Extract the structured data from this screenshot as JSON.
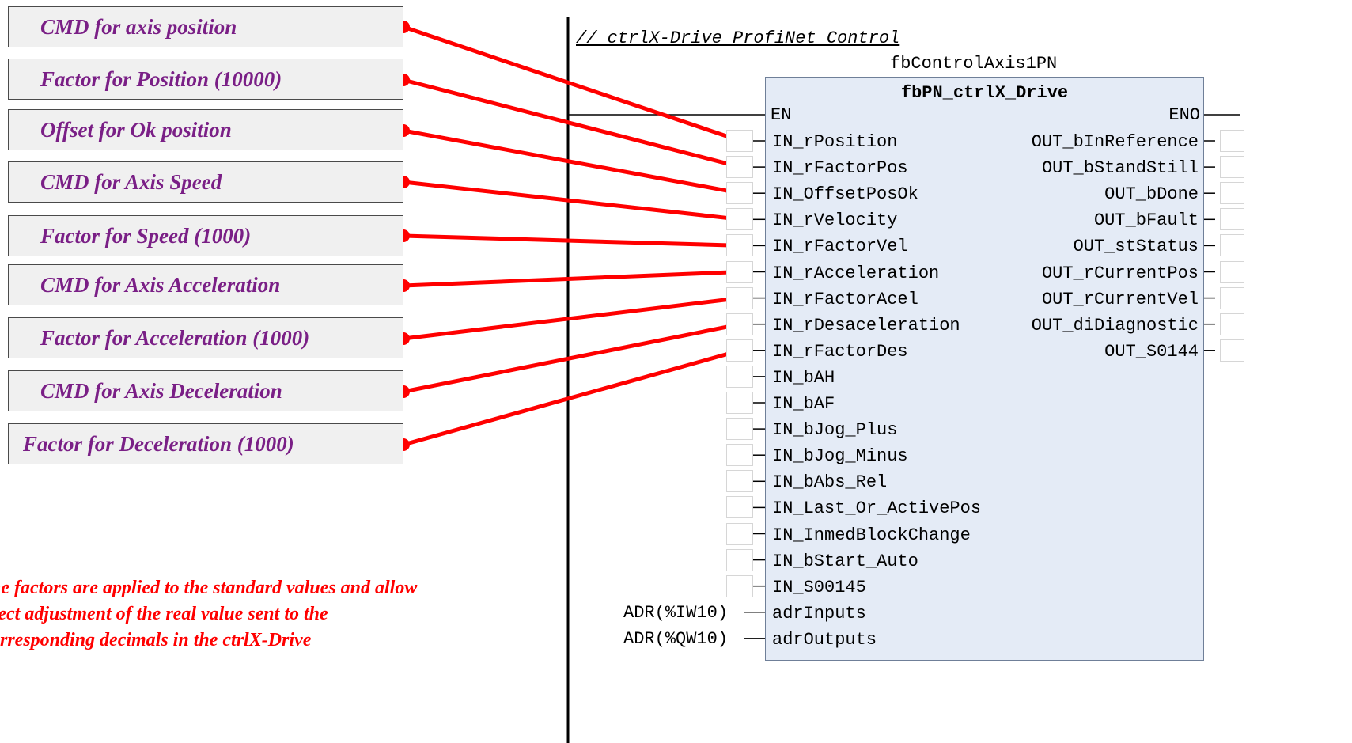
{
  "labels": [
    "CMD for axis position",
    "Factor for Position (10000)",
    "Offset for Ok position",
    "CMD for Axis Speed",
    "Factor for Speed (1000)",
    "CMD for Axis Acceleration",
    "Factor for Acceleration (1000)",
    "CMD for Axis Deceleration",
    "Factor for Deceleration (1000)"
  ],
  "note": [
    "he factors are applied to the standard values and allow",
    "rect adjustment of the real value sent to the",
    "orresponding decimals in the ctrlX-Drive"
  ],
  "comment": "// ctrlX-Drive ProfiNet Control",
  "instance_name": "fbControlAxis1PN",
  "block_type": "fbPN_ctrlX_Drive",
  "en_label": "EN",
  "eno_label": "ENO",
  "inputs": [
    "IN_rPosition",
    "IN_rFactorPos",
    "IN_OffsetPosOk",
    "IN_rVelocity",
    "IN_rFactorVel",
    "IN_rAcceleration",
    "IN_rFactorAcel",
    "IN_rDesaceleration",
    "IN_rFactorDes",
    "IN_bAH",
    "IN_bAF",
    "IN_bJog_Plus",
    "IN_bJog_Minus",
    "IN_bAbs_Rel",
    "IN_Last_Or_ActivePos",
    "IN_InmedBlockChange",
    "IN_bStart_Auto",
    "IN_S00145",
    "adrInputs",
    "adrOutputs"
  ],
  "input_args": {
    "adrInputs": "ADR(%IW10)",
    "adrOutputs": "ADR(%QW10)"
  },
  "outputs": [
    "OUT_bInReference",
    "OUT_bStandStill",
    "OUT_bDone",
    "OUT_bFault",
    "OUT_stStatus",
    "OUT_rCurrentPos",
    "OUT_rCurrentVel",
    "OUT_diDiagnostic",
    "OUT_S0144"
  ],
  "colors": {
    "wire": "#ff0000",
    "label_text": "#7a1f86",
    "note_text": "#ff0000",
    "block_fill": "#e4ebf6"
  }
}
